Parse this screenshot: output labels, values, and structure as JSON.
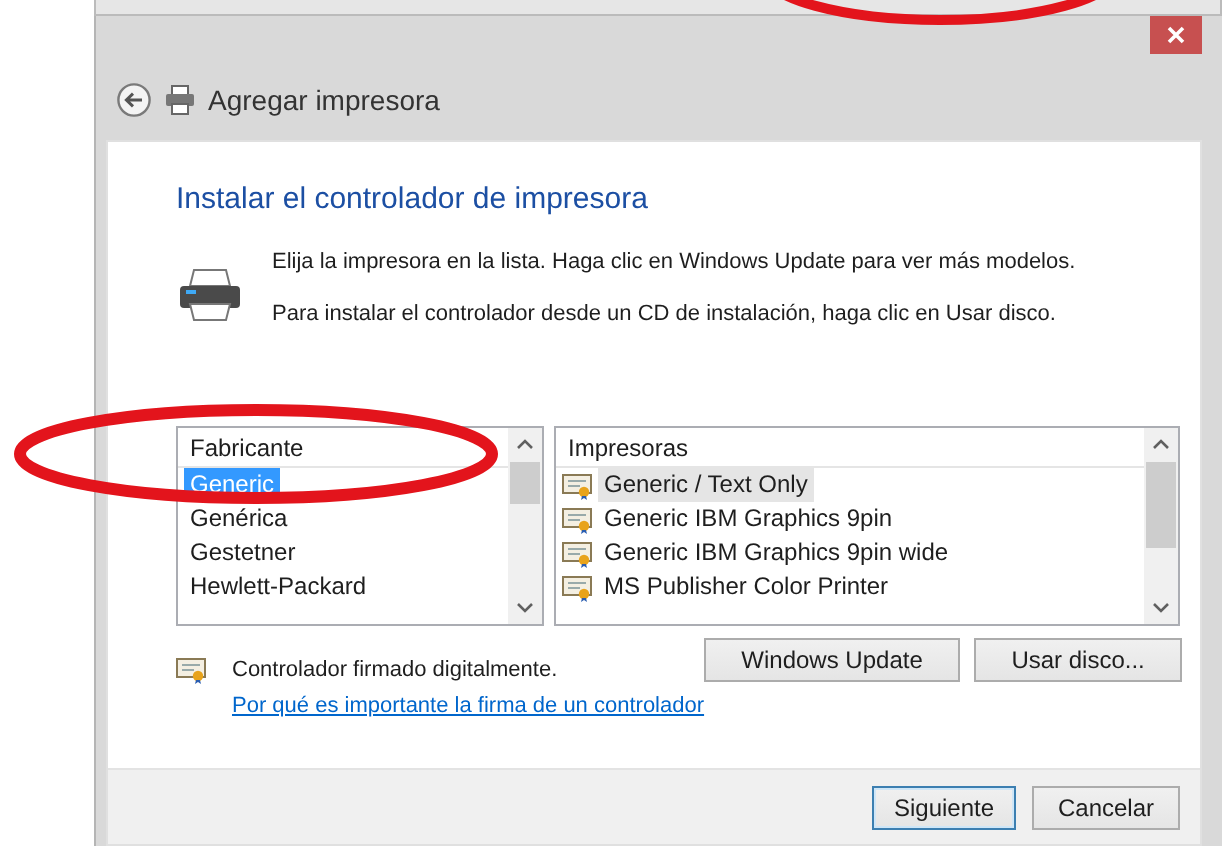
{
  "window": {
    "title": "Agregar impresora"
  },
  "heading": "Instalar el controlador de impresora",
  "instructions": [
    "Elija la impresora en la lista. Haga clic en Windows Update para ver más modelos.",
    "Para instalar el controlador desde un CD de instalación, haga clic en Usar disco."
  ],
  "manufacturers": {
    "header": "Fabricante",
    "items": [
      {
        "label": "Generic",
        "selected": true
      },
      {
        "label": "Genérica",
        "selected": false
      },
      {
        "label": "Gestetner",
        "selected": false
      },
      {
        "label": "Hewlett-Packard",
        "selected": false
      }
    ]
  },
  "printers": {
    "header": "Impresoras",
    "items": [
      {
        "label": "Generic / Text Only",
        "selected": true
      },
      {
        "label": "Generic IBM Graphics 9pin",
        "selected": false
      },
      {
        "label": "Generic IBM Graphics 9pin wide",
        "selected": false
      },
      {
        "label": "MS Publisher Color Printer",
        "selected": false
      }
    ]
  },
  "signed_status": "Controlador firmado digitalmente.",
  "signature_link": "Por qué es importante la firma de un controlador",
  "list_buttons": [
    {
      "label": "Windows Update",
      "default": false
    },
    {
      "label": "Usar disco...",
      "default": false
    }
  ],
  "footer_buttons": [
    {
      "label": "Siguiente",
      "default": true
    },
    {
      "label": "Cancelar",
      "default": false
    }
  ]
}
